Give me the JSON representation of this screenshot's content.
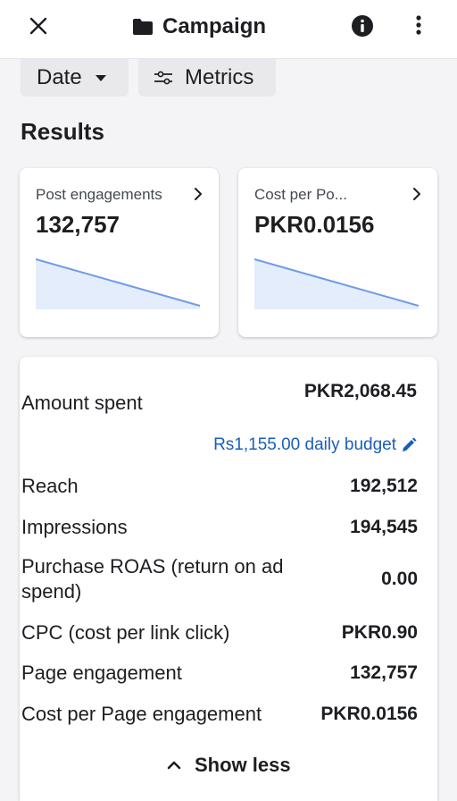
{
  "header": {
    "title": "Campaign",
    "icons": {
      "close": "close-icon",
      "folder": "folder-icon",
      "info": "info-icon",
      "more": "more-vertical-icon"
    }
  },
  "filters": {
    "date_label": "Date",
    "metrics_label": "Metrics"
  },
  "results": {
    "title": "Results",
    "cards": [
      {
        "label": "Post engagements",
        "value": "132,757",
        "trend": [
          1.0,
          0.0
        ]
      },
      {
        "label": "Cost per Po...",
        "value": "PKR0.0156",
        "trend": [
          1.0,
          0.0
        ]
      }
    ]
  },
  "details": {
    "amount_spent_label": "Amount spent",
    "amount_spent_value": "PKR2,068.45",
    "daily_budget_text": "Rs1,155.00 daily budget",
    "rows": [
      {
        "label": "Reach",
        "value": "192,512"
      },
      {
        "label": "Impressions",
        "value": "194,545"
      },
      {
        "label": "Purchase ROAS (return on ad spend)",
        "value": "0.00"
      },
      {
        "label": "CPC (cost per link click)",
        "value": "PKR0.90"
      },
      {
        "label": "Page engagement",
        "value": "132,757"
      },
      {
        "label": "Cost per Page engagement",
        "value": "PKR0.0156"
      }
    ],
    "show_less_label": "Show less"
  },
  "colors": {
    "accent": "#1a5eb8",
    "spark_line": "#6f9ae6",
    "spark_fill": "#e3edfc"
  }
}
